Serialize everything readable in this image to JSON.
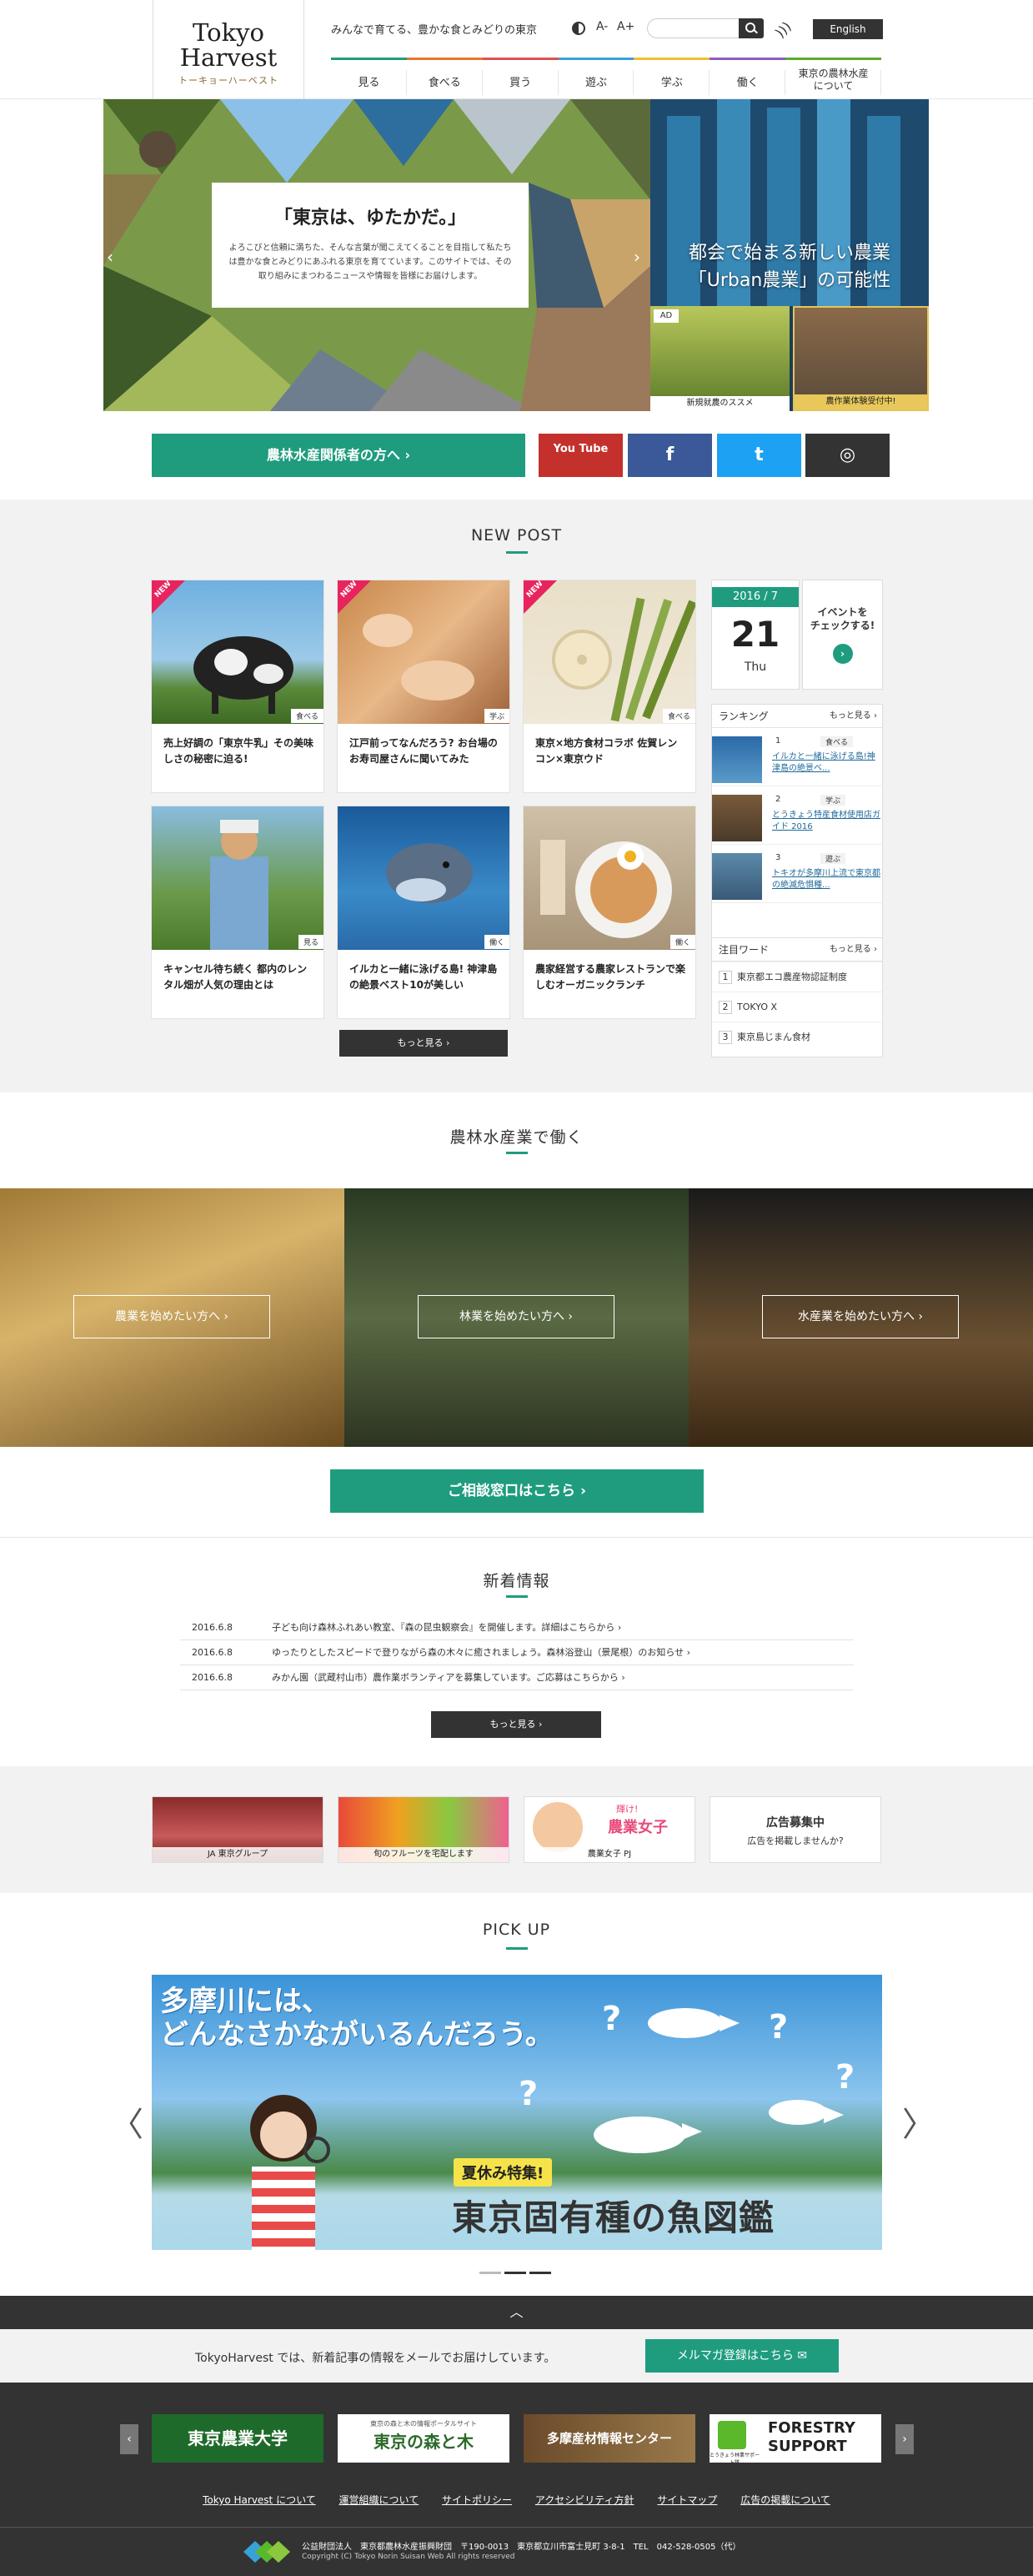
{
  "header": {
    "logo_line1": "Tokyo",
    "logo_line2": "Harvest",
    "logo_kana": "トーキョーハーベスト",
    "tagline": "みんなで育てる、豊かな食とみどりの東京",
    "font_small": "A-",
    "font_large": "A+",
    "search_placeholder": "",
    "english_label": "English",
    "nav": [
      {
        "label": "見る",
        "color": "#1f9c7e"
      },
      {
        "label": "食べる",
        "color": "#e8762b"
      },
      {
        "label": "買う",
        "color": "#d9534f"
      },
      {
        "label": "遊ぶ",
        "color": "#3aa0d8"
      },
      {
        "label": "学ぶ",
        "color": "#f0c030"
      },
      {
        "label": "働く",
        "color": "#8e5cc4"
      },
      {
        "label": "東京の農林水産について",
        "color": "#5aa832"
      }
    ]
  },
  "hero": {
    "title": "「東京は、ゆたかだ。」",
    "body": "よろこびと信頼に満ちた、そんな言葉が聞こえてくることを目指して私たちは豊かな食とみどりにあふれる東京を育てています。このサイトでは、その取り組みにまつわるニュースや情報を皆様にお届けします。",
    "right_title_line1": "都会で始まる新しい農業",
    "right_title_line2": "「Urban農業」の可能性",
    "ad_label": "AD",
    "ad1_caption": "新規就農のススメ",
    "ad2_caption": "農作業体験受付中!",
    "prev": "‹",
    "next": "›"
  },
  "sns": {
    "industry_label": "農林水産関係者の方へ ›",
    "youtube": "You Tube",
    "facebook": "f",
    "twitter": "t",
    "instagram": "◎"
  },
  "newpost": {
    "title": "NEW POST",
    "new_label": "NEW",
    "posts": [
      {
        "text": "売上好調の「東京牛乳」その美味しさの秘密に迫る!",
        "tag": "食べる",
        "new": true
      },
      {
        "text": "江戸前ってなんだろう? お台場のお寿司屋さんに聞いてみた",
        "tag": "学ぶ",
        "new": true
      },
      {
        "text": "東京×地方食材コラボ 佐賀レンコン×東京ウド",
        "tag": "食べる",
        "new": true
      },
      {
        "text": "キャンセル待ち続く 都内のレンタル畑が人気の理由とは",
        "tag": "見る",
        "new": false
      },
      {
        "text": "イルカと一緒に泳げる島! 神津島の絶景ベスト10が美しい",
        "tag": "働く",
        "new": false
      },
      {
        "text": "農家経営する農家レストランで楽しむオーガニックランチ",
        "tag": "働く",
        "new": false
      }
    ],
    "calendar_month": "2016 / 7",
    "calendar_day": "21",
    "calendar_dow": "Thu",
    "event_line1": "イベントを",
    "event_line2": "チェックする!",
    "event_arrow": "›",
    "ranking_title": "ランキング",
    "ranking_more": "もっと見る ›",
    "ranking": [
      {
        "no": "1",
        "tag": "食べる",
        "title": "イルカと一緒に泳げる島!神津島の絶景ベ..."
      },
      {
        "no": "2",
        "tag": "学ぶ",
        "title": "とうきょう特産食材使用店ガイド 2016"
      },
      {
        "no": "3",
        "tag": "遊ぶ",
        "title": "トキオが多摩川上流で東京都の絶滅危惧種..."
      }
    ],
    "keyword_title": "注目ワード",
    "keyword_more": "もっと見る ›",
    "keywords": [
      "東京都エコ農産物認証制度",
      "TOKYO X",
      "東京島じまん食材"
    ],
    "more_label": "もっと見る ›"
  },
  "work": {
    "title": "農林水産業で働く",
    "agri": "農業を始めたい方へ ›",
    "forest": "林業を始めたい方へ ›",
    "fish": "水産業を始めたい方へ ›",
    "consult": "ご相談窓口はこちら ›"
  },
  "news": {
    "title": "新着情報",
    "items": [
      {
        "date": "2016.6.8",
        "text": "子ども向け森林ふれあい教室、『森の昆虫観察会』を開催します。詳細はこちらから ›"
      },
      {
        "date": "2016.6.8",
        "text": "ゆったりとしたスピードで登りながら森の木々に癒されましょう。森林浴登山（景尾根）のお知らせ ›"
      },
      {
        "date": "2016.6.8",
        "text": "みかん園（武蔵村山市）農作業ボランティアを募集しています。ご応募はこちらから ›"
      }
    ],
    "more_label": "もっと見る ›"
  },
  "banners": {
    "ja": "JA 東京グループ",
    "fruit": "旬のフルーツを宅配します",
    "joshi_caption": "農業女子 PJ",
    "joshi_title": "農業女子",
    "joshi_sub": "輝け!",
    "ad_title": "広告募集中",
    "ad_sub": "広告を掲載しませんか?"
  },
  "pickup": {
    "title": "PICK UP",
    "headline_line1": "多摩川には、",
    "headline_line2": "どんなさかながいるんだろう。",
    "summer": "夏休み特集!",
    "main": "東京固有種の魚図鑑",
    "prev": "〈",
    "next": "〉"
  },
  "footer": {
    "pagetop": "︿",
    "mail_text": "TokyoHarvest では、新着記事の情報をメールでお届けしています。",
    "mail_button": "メルマガ登録はこちら ✉",
    "bn1": "東京農業大学",
    "bn2_small": "東京の森と木の情報ポータルサイト",
    "bn2": "東京の森と木",
    "bn3": "多摩産材情報センター",
    "bn4_line1": "FORESTRY",
    "bn4_line2": "SUPPORT",
    "bn4_small": "とうきょう林業サポート隊",
    "arrow_l": "‹",
    "arrow_r": "›",
    "links": [
      "Tokyo Harvest について",
      "運営組織について",
      "サイトポリシー",
      "アクセシビリティ方針",
      "サイトマップ",
      "広告の掲載について"
    ],
    "org": "公益財団法人　東京都農林水産振興財団　〒190-0013　東京都立川市富士見町 3-8-1　TEL　042-528-0505（代）",
    "copy": "Copyright (C) Tokyo Norin Suisan Web All rights reserved"
  }
}
